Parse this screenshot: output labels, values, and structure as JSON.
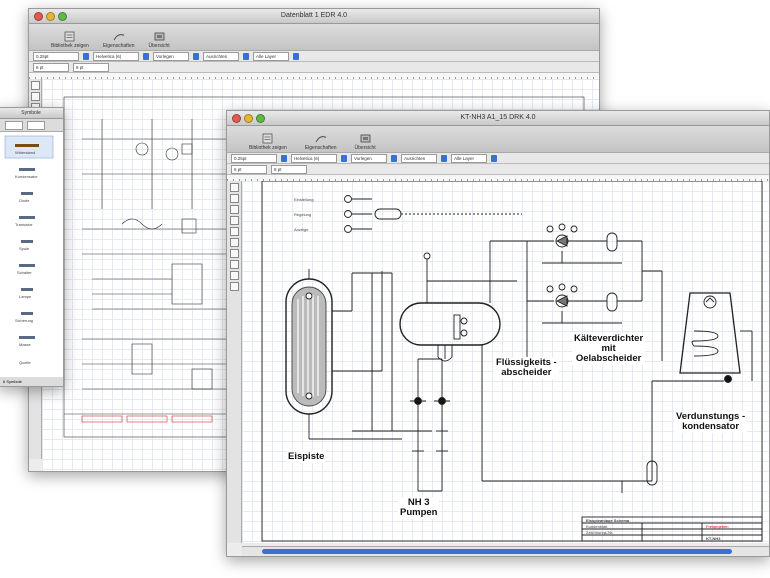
{
  "back_window": {
    "title": "Datenblatt 1 EDR 4.0",
    "toolbar": [
      {
        "label": "Bibliothek zeigen",
        "icon": "library-icon"
      },
      {
        "label": "Eigenschaften",
        "icon": "properties-icon"
      },
      {
        "label": "Übersicht",
        "icon": "overview-icon"
      }
    ],
    "line_width": "0.25pt",
    "font_name": "Helvetica (6)",
    "arrange_label": "Vorlegen",
    "align_label": "Ausrichten",
    "layer_label": "Alle Layer",
    "size_label": "6 pt",
    "zoom_label": "8 pt"
  },
  "library_panel": {
    "title": "Symbole",
    "items": [
      "Widerstand",
      "Kondensator",
      "Diode",
      "Transistor",
      "Spule",
      "Schalter",
      "Lampe",
      "Sicherung",
      "Masse",
      "Quelle"
    ],
    "count": "6 Symbole"
  },
  "front_window": {
    "title": "KT-NH3 A1_15 DRK 4.0",
    "toolbar": [
      {
        "label": "Bibliothek zeigen",
        "icon": "library-icon"
      },
      {
        "label": "Eigenschaften",
        "icon": "properties-icon"
      },
      {
        "label": "Übersicht",
        "icon": "overview-icon"
      }
    ],
    "line_width": "0.25pt",
    "font_name": "Helvetica (6)",
    "arrange_label": "Vorlegen",
    "align_label": "Ausrichten",
    "layer_label": "Alle Layer",
    "size_label": "6 pt",
    "zoom_label": "8 pt",
    "diagram": {
      "labels": {
        "eispiste": "Eispiste",
        "pumps": "NH 3\nPumpen",
        "separator": "Flüssigkeits -\nabscheider",
        "compressor": "Kälteverdichter\nmit\nOelabscheider",
        "condenser": "Verdunstungs -\nkondensator"
      },
      "controls": [
        "Einstellung",
        "Regelung",
        "Anzeige"
      ],
      "title_block": {
        "header": "Eisspieanlage Schema",
        "row1": "Kundenblatt",
        "row2": "Zeichnungs-Nr.",
        "status": "Freigegeben",
        "number": "KT-NH3"
      }
    }
  }
}
